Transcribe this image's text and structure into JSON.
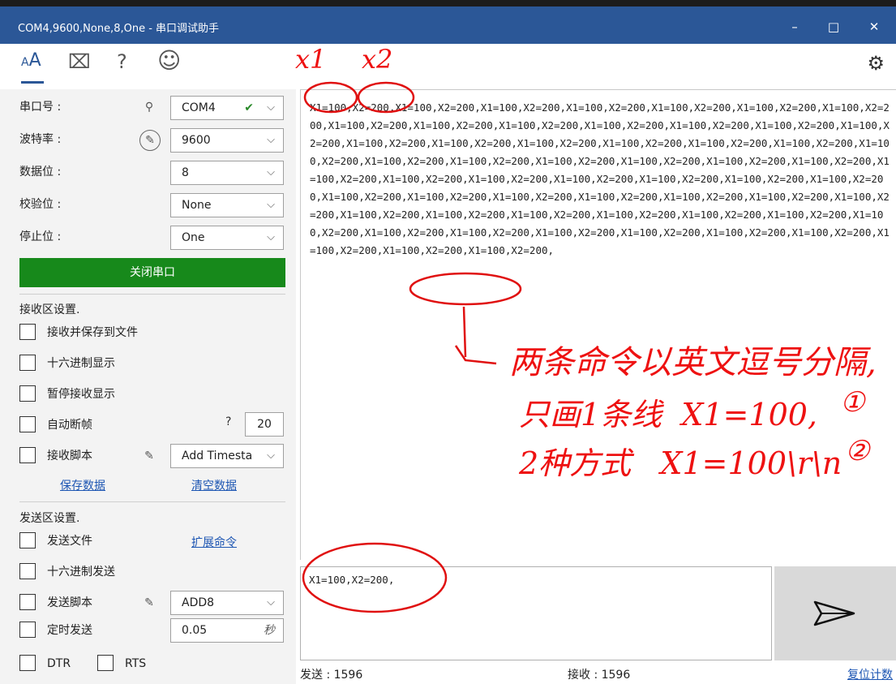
{
  "window": {
    "title": "COM4,9600,None,8,One - 串口调试助手",
    "minimize": "–",
    "maximize": "□",
    "close": "✕"
  },
  "toolbar": {
    "font_icon": "AA",
    "crop_icon": "⌧",
    "help_icon": "?",
    "smile_icon": "☺",
    "settings_icon": "⚙"
  },
  "serial": {
    "port_label": "串口号 :",
    "port_value": "COM4",
    "baud_label": "波特率 :",
    "baud_value": "9600",
    "databits_label": "数据位 :",
    "databits_value": "8",
    "parity_label": "校验位 :",
    "parity_value": "None",
    "stopbits_label": "停止位 :",
    "stopbits_value": "One",
    "close_port_label": "关闭串口"
  },
  "receive_settings": {
    "heading": "接收区设置.",
    "save_to_file": "接收并保存到文件",
    "hex_display": "十六进制显示",
    "pause_display": "暂停接收显示",
    "auto_frame": "自动断帧",
    "auto_frame_q": "?",
    "auto_frame_value": "20",
    "recv_script": "接收脚本",
    "recv_script_value": "Add Timesta",
    "save_data": "保存数据",
    "clear_data": "清空数据"
  },
  "send_settings": {
    "heading": "发送区设置.",
    "send_file": "发送文件",
    "ext_cmd": "扩展命令",
    "hex_send": "十六进制发送",
    "send_script": "发送脚本",
    "send_script_value": "ADD8",
    "timed_send": "定时发送",
    "timed_value": "0.05",
    "timed_unit": "秒",
    "dtr": "DTR",
    "rts": "RTS"
  },
  "receive_text": "X1=100,X2=200,X1=100,X2=200,X1=100,X2=200,X1=100,X2=200,X1=100,X2=200,X1=100,X2=200,X1=100,X2=200,X1=100,X2=200,X1=100,X2=200,X1=100,X2=200,X1=100,X2=200,X1=100,X2=200,X1=100,X2=200,X1=100,X2=200,X1=100,X2=200,X1=100,X2=200,X1=100,X2=200,X1=100,X2=200,X1=100,X2=200,X1=100,X2=200,X1=100,X2=200,X1=100,X2=200,X1=100,X2=200,X1=100,X2=200,X1=100,X2=200,X1=100,X2=200,X1=100,X2=200,X1=100,X2=200,X1=100,X2=200,X1=100,X2=200,X1=100,X2=200,X1=100,X2=200,X1=100,X2=200,X1=100,X2=200,X1=100,X2=200,X1=100,X2=200,X1=100,X2=200,X1=100,X2=200,X1=100,X2=200,X1=100,X2=200,X1=100,X2=200,X1=100,X2=200,X1=100,X2=200,X1=100,X2=200,X1=100,X2=200,X1=100,X2=200,X1=100,X2=200,X1=100,X2=200,X1=100,X2=200,X1=100,X2=200,X1=100,X2=200,X1=100,X2=200,X1=100,X2=200,X1=100,X2=200,X1=100,X2=200,X1=100,X2=200,X1=100,X2=200,",
  "send_text": "X1=100,X2=200,",
  "status": {
    "sent": "发送 : 1596",
    "received": "接收 : 1596",
    "reset": "复位计数"
  },
  "annotations": {
    "x1": "x1",
    "x2": "x2",
    "line1": "两条命令以英文逗号分隔,",
    "line2": "只画1条线  X1=100,",
    "line3": "2种方式   X1=100\\r\\n",
    "mark1": "①",
    "mark2": "②",
    "color": "#e01010"
  }
}
